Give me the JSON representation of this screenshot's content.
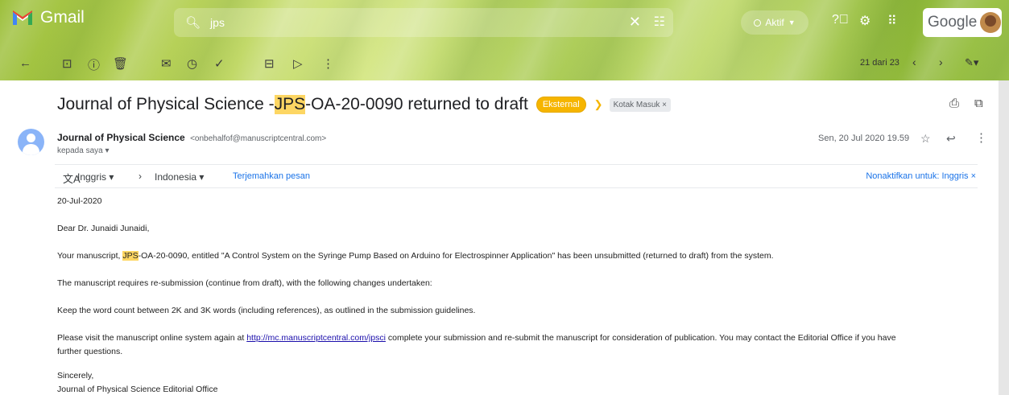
{
  "app": {
    "name": "Gmail",
    "brand_word": "Google"
  },
  "search": {
    "query": "jps"
  },
  "status": {
    "label": "Aktif"
  },
  "pager": {
    "text": "21 dari 23"
  },
  "email": {
    "subject_pre": "Journal of Physical Science - ",
    "subject_hl": "JPS",
    "subject_post": "-OA-20-0090 returned to draft",
    "label_external": "Eksternal",
    "label_inbox": "Kotak Masuk ×",
    "sender_name": "Journal of Physical Science",
    "sender_email": "<onbehalfof@manuscriptcentral.com>",
    "to": "kepada saya ▾",
    "date": "Sen, 20 Jul 2020 19.59"
  },
  "translate": {
    "source": "Inggris ▾",
    "target": "Indonesia ▾",
    "translate_link": "Terjemahkan pesan",
    "disable_link": "Nonaktifkan untuk: Inggris ×"
  },
  "body": {
    "date": "20-Jul-2020",
    "greeting": "Dear Dr. Junaidi Junaidi,",
    "p1_pre": "Your manuscript, ",
    "p1_hl": "JPS",
    "p1_post": "-OA-20-0090, entitled \"A Control System on the Syringe Pump Based on Arduino for Electrospinner Application\" has been unsubmitted (returned to draft) from the system.",
    "p2": "The manuscript requires re-submission (continue from draft), with the following changes undertaken:",
    "p3": "Keep the word count between 2K and 3K words (including references), as outlined in the submission guidelines.",
    "p4_pre": "Please visit the manuscript online system again at ",
    "p4_link": "http://mc.manuscriptcentral.com/jpsci",
    "p4_post": " complete your submission and re-submit the manuscript for consideration of publication.  You may contact the Editorial Office if you have",
    "p4_line2": "further questions.",
    "closing": "Sincerely,",
    "signature": "Journal of Physical Science Editorial Office"
  },
  "colors": {
    "accent": "#f6b500",
    "highlight": "#fdd663",
    "link": "#1a73e8"
  }
}
